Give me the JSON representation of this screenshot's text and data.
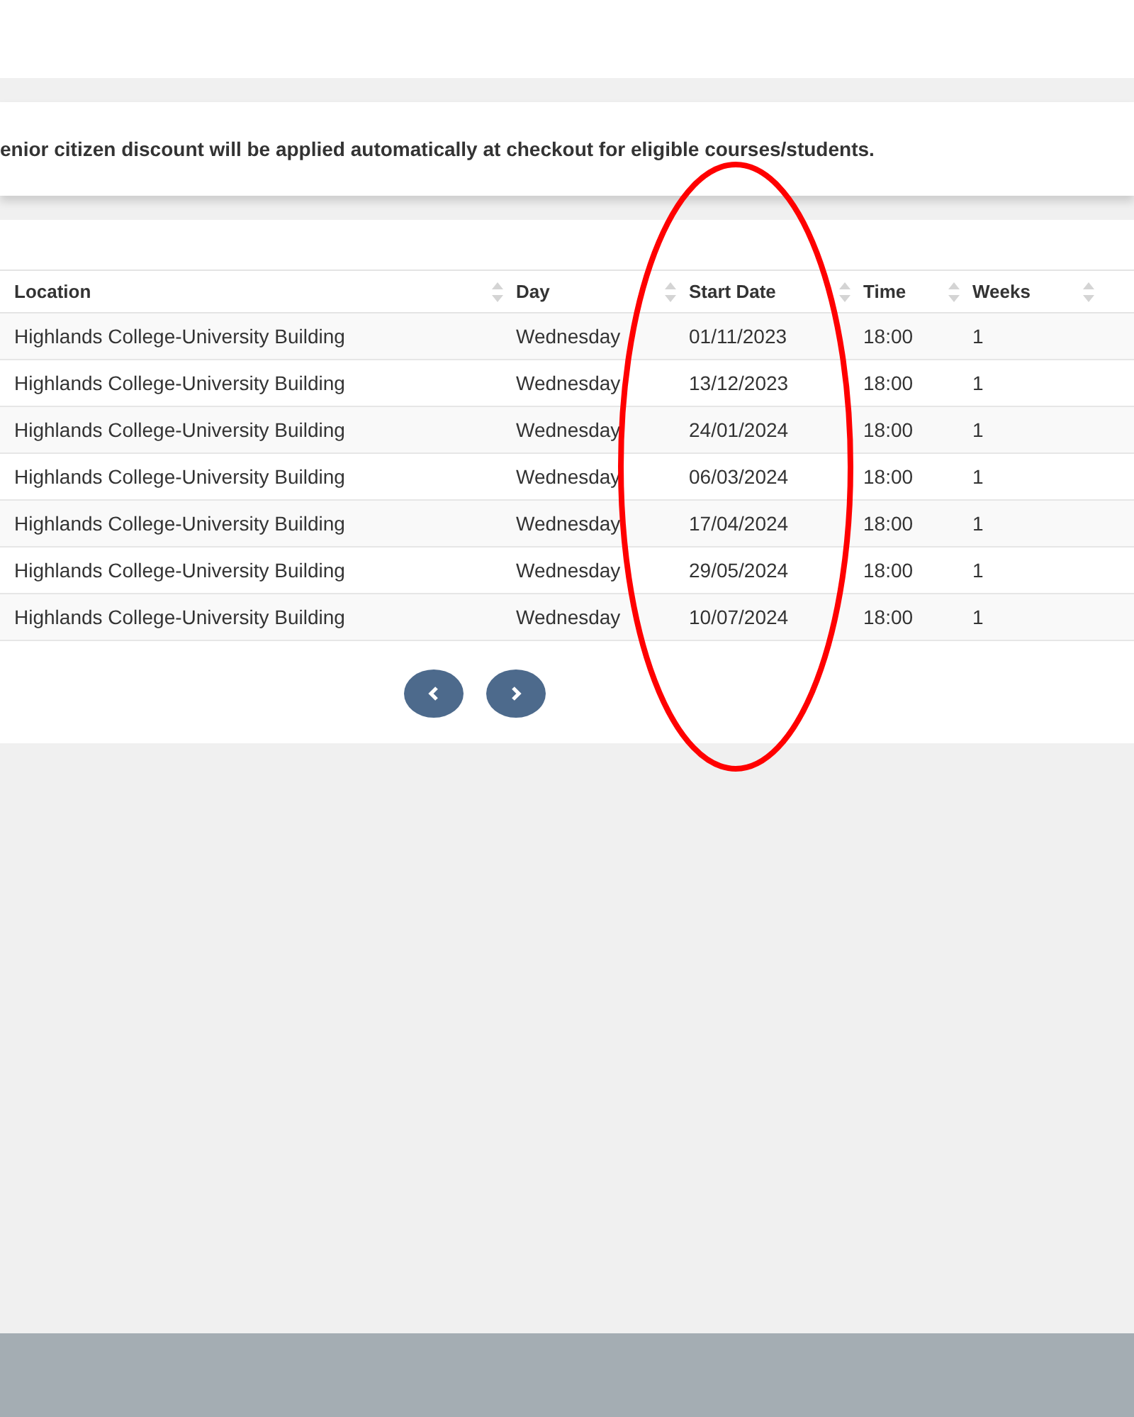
{
  "notice": {
    "text": "enior citizen discount will be applied automatically at checkout for eligible courses/students."
  },
  "table": {
    "columns": [
      "Location",
      "Day",
      "Start Date",
      "Time",
      "Weeks"
    ],
    "rows": [
      [
        "Highlands College-University Building",
        "Wednesday",
        "01/11/2023",
        "18:00",
        "1"
      ],
      [
        "Highlands College-University Building",
        "Wednesday",
        "13/12/2023",
        "18:00",
        "1"
      ],
      [
        "Highlands College-University Building",
        "Wednesday",
        "24/01/2024",
        "18:00",
        "1"
      ],
      [
        "Highlands College-University Building",
        "Wednesday",
        "06/03/2024",
        "18:00",
        "1"
      ],
      [
        "Highlands College-University Building",
        "Wednesday",
        "17/04/2024",
        "18:00",
        "1"
      ],
      [
        "Highlands College-University Building",
        "Wednesday",
        "29/05/2024",
        "18:00",
        "1"
      ],
      [
        "Highlands College-University Building",
        "Wednesday",
        "10/07/2024",
        "18:00",
        "1"
      ]
    ]
  },
  "pagination": {
    "buttons": [
      {
        "kind": "previous"
      },
      {
        "kind": "next"
      }
    ]
  },
  "annotation": {
    "kind": "ellipse"
  }
}
